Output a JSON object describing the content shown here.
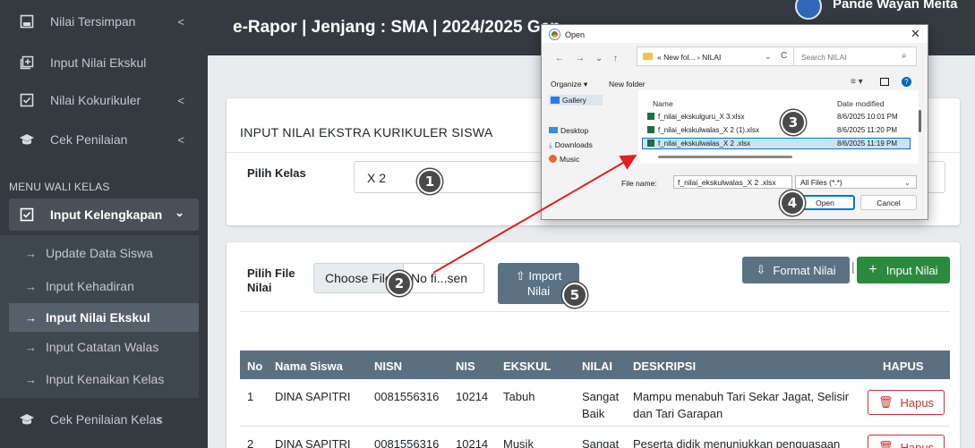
{
  "sidebar": {
    "items": [
      {
        "label": "Nilai Tersimpan",
        "icon": "save-icon",
        "chevron": "<"
      },
      {
        "label": "Input Nilai Ekskul",
        "icon": "add-box-icon"
      },
      {
        "label": "Nilai Kokurikuler",
        "icon": "check-box-icon",
        "chevron": "<"
      },
      {
        "label": "Cek Penilaian",
        "icon": "graduation-cap-icon",
        "chevron": "<"
      }
    ],
    "section_header": "MENU WALI KELAS",
    "active_parent": {
      "label": "Input Kelengkapan",
      "icon": "check-box-icon",
      "chevron": "⌄"
    },
    "sub_items": [
      {
        "label": "Update Data Siswa"
      },
      {
        "label": "Input Kehadiran"
      },
      {
        "label": "Input Nilai Ekskul"
      },
      {
        "label": "Input Catatan Walas"
      },
      {
        "label": "Input Kenaikan Kelas"
      }
    ],
    "bottom_item": {
      "label": "Cek Penilaian Kelas",
      "icon": "graduation-cap-icon",
      "chevron": "<"
    },
    "arrow_glyph": "→"
  },
  "header": {
    "app_title": "e-Rapor | Jenjang : SMA | 2024/2025 Gen",
    "user_name": "Pande Wayan Meita"
  },
  "form": {
    "card_title": "INPUT NILAI EKSTRA KURIKULER SISWA",
    "class_label": "Pilih Kelas",
    "class_value": "X 2",
    "file_label_line1": "Pilih File",
    "file_label_line2": "Nilai",
    "choose_file": "Choose File",
    "no_file": "No fi...sen",
    "import_line1": "Import",
    "import_line2": "Nilai",
    "format_button": "Format Nilai",
    "input_button": "Input Nilai",
    "separator": "|"
  },
  "table": {
    "headers": [
      "No",
      "Nama Siswa",
      "NISN",
      "NIS",
      "EKSKUL",
      "NILAI",
      "DESKRIPSI",
      "HAPUS"
    ],
    "rows": [
      {
        "no": "1",
        "nama": "DINA SAPITRI",
        "nisn": "0081556316",
        "nis": "10214",
        "ekskul": "Tabuh",
        "nilai_1": "Sangat",
        "nilai_2": "Baik",
        "desk_1": "Mampu menabuh Tari Sekar Jagat, Selisir",
        "desk_2": "dan Tari Garapan",
        "hapus": "Hapus"
      },
      {
        "no": "2",
        "nama": "DINA SAPITRI",
        "nisn": "0081556316",
        "nis": "10214",
        "ekskul": "Musik",
        "nilai_1": "Sangat",
        "nilai_2": "",
        "desk_1": "Peserta didik menunjukkan penguasaan",
        "desk_2": "",
        "hapus": "Hapus"
      }
    ]
  },
  "dialog": {
    "title": "Open",
    "close": "✕",
    "nav_back": "←",
    "nav_forward": "→",
    "nav_down": "⌄",
    "nav_up": "↑",
    "address": "« New fol... › NILAI",
    "refresh": "C",
    "search_placeholder": "Search NILAI",
    "organize": "Organize ▾",
    "new_folder": "New folder",
    "left_nav": [
      "Gallery",
      "Desktop",
      "Downloads",
      "Music"
    ],
    "col_name": "Name",
    "col_date": "Date modified",
    "files": [
      {
        "name": "f_nilai_ekskulguru_X 3.xlsx",
        "date": "8/6/2025 10:01 PM"
      },
      {
        "name": "f_nilai_ekskulwalas_X 2 (1).xlsx",
        "date": "8/6/2025 11:20 PM"
      },
      {
        "name": "f_nilai_ekskulwalas_X 2 .xlsx",
        "date": "8/6/2025 11:19 PM",
        "selected": true
      }
    ],
    "file_name_label": "File name:",
    "file_name_value": "f_nilai_ekskulwalas_X 2 .xlsx",
    "file_type": "All Files (*.*)",
    "open_button": "Open",
    "cancel_button": "Cancel"
  },
  "markers": [
    "1",
    "2",
    "3",
    "4",
    "5"
  ],
  "colors": {
    "sidebar_bg": "#343a40",
    "table_header": "#5a7080",
    "import_button": "#5b7283",
    "input_button": "#2b8a3e",
    "hapus_red": "#c0392b",
    "arrow_red": "#e02020"
  }
}
